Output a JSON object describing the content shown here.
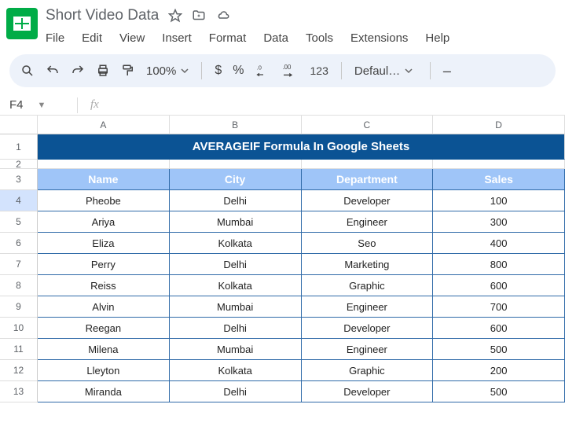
{
  "doc_title": "Short Video Data",
  "menubar": [
    "File",
    "Edit",
    "View",
    "Insert",
    "Format",
    "Data",
    "Tools",
    "Extensions",
    "Help"
  ],
  "toolbar": {
    "zoom": "100%",
    "currency": "$",
    "percent": "%",
    "num_fmt": "123",
    "font": "Defaul…",
    "minus": "–"
  },
  "name_box": "F4",
  "fx_label": "fx",
  "formula": "",
  "columns": [
    "A",
    "B",
    "C",
    "D"
  ],
  "banner": "AVERAGEIF  Formula In Google Sheets",
  "headers": [
    "Name",
    "City",
    "Department",
    "Sales"
  ],
  "rows": [
    {
      "n": "1"
    },
    {
      "n": "2"
    },
    {
      "n": "3"
    },
    {
      "n": "4",
      "d": [
        "Pheobe",
        "Delhi",
        "Developer",
        "100"
      ]
    },
    {
      "n": "5",
      "d": [
        "Ariya",
        "Mumbai",
        "Engineer",
        "300"
      ]
    },
    {
      "n": "6",
      "d": [
        "Eliza",
        "Kolkata",
        "Seo",
        "400"
      ]
    },
    {
      "n": "7",
      "d": [
        "Perry",
        "Delhi",
        "Marketing",
        "800"
      ]
    },
    {
      "n": "8",
      "d": [
        "Reiss",
        "Kolkata",
        "Graphic",
        "600"
      ]
    },
    {
      "n": "9",
      "d": [
        "Alvin",
        "Mumbai",
        "Engineer",
        "700"
      ]
    },
    {
      "n": "10",
      "d": [
        "Reegan",
        "Delhi",
        "Developer",
        "600"
      ]
    },
    {
      "n": "11",
      "d": [
        "Milena",
        "Mumbai",
        "Engineer",
        "500"
      ]
    },
    {
      "n": "12",
      "d": [
        "Lleyton",
        "Kolkata",
        "Graphic",
        "200"
      ]
    },
    {
      "n": "13",
      "d": [
        "Miranda",
        "Delhi",
        "Developer",
        "500"
      ]
    }
  ],
  "active_row": "4"
}
